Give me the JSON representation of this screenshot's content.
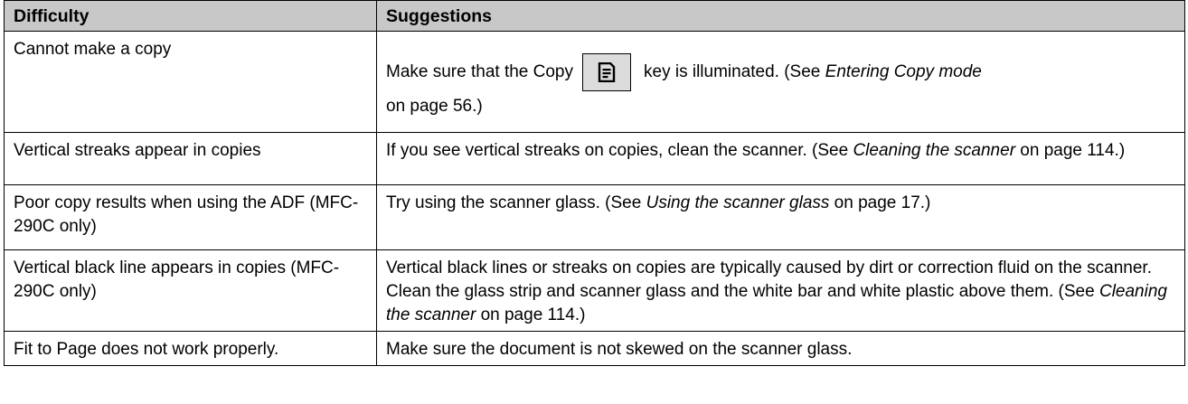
{
  "table": {
    "header": {
      "difficulty": "Difficulty",
      "suggestions": "Suggestions"
    },
    "rows": [
      {
        "difficulty": "Cannot make a copy",
        "s_pre": "Make sure that the Copy",
        "s_mid": "key is illuminated. (See ",
        "s_ref": "Entering Copy mode",
        "s_line2": "on page 56.)",
        "copy_key_icon": "copy-document-icon"
      },
      {
        "difficulty": "Vertical streaks appear in copies",
        "s_pre": "If you see vertical streaks on copies, clean the scanner. (See ",
        "s_ref": "Cleaning the scanner",
        "s_post": " on page 114.)"
      },
      {
        "difficulty": "Poor copy results when using the ADF (MFC-290C only)",
        "s_pre": "Try using the scanner glass. (See ",
        "s_ref": "Using the scanner glass",
        "s_post": " on page 17.)"
      },
      {
        "difficulty": "Vertical black line appears in copies (MFC-290C only)",
        "s_pre": "Vertical black lines or streaks on copies are typically caused by dirt or correction fluid on the scanner. Clean the glass strip and scanner glass and the white bar and white plastic above them. (See ",
        "s_ref": "Cleaning the scanner",
        "s_post": " on page 114.)"
      },
      {
        "difficulty": "Fit to Page does not work properly.",
        "s_pre": "Make sure the document is not skewed on the scanner glass."
      }
    ]
  }
}
